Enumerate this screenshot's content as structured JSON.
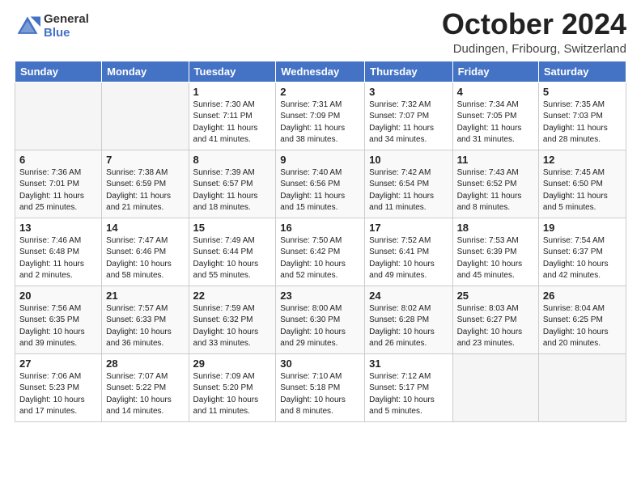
{
  "header": {
    "logo_general": "General",
    "logo_blue": "Blue",
    "month_title": "October 2024",
    "location": "Dudingen, Fribourg, Switzerland"
  },
  "columns": [
    "Sunday",
    "Monday",
    "Tuesday",
    "Wednesday",
    "Thursday",
    "Friday",
    "Saturday"
  ],
  "weeks": [
    [
      {
        "day": "",
        "info": ""
      },
      {
        "day": "",
        "info": ""
      },
      {
        "day": "1",
        "info": "Sunrise: 7:30 AM\nSunset: 7:11 PM\nDaylight: 11 hours and 41 minutes."
      },
      {
        "day": "2",
        "info": "Sunrise: 7:31 AM\nSunset: 7:09 PM\nDaylight: 11 hours and 38 minutes."
      },
      {
        "day": "3",
        "info": "Sunrise: 7:32 AM\nSunset: 7:07 PM\nDaylight: 11 hours and 34 minutes."
      },
      {
        "day": "4",
        "info": "Sunrise: 7:34 AM\nSunset: 7:05 PM\nDaylight: 11 hours and 31 minutes."
      },
      {
        "day": "5",
        "info": "Sunrise: 7:35 AM\nSunset: 7:03 PM\nDaylight: 11 hours and 28 minutes."
      }
    ],
    [
      {
        "day": "6",
        "info": "Sunrise: 7:36 AM\nSunset: 7:01 PM\nDaylight: 11 hours and 25 minutes."
      },
      {
        "day": "7",
        "info": "Sunrise: 7:38 AM\nSunset: 6:59 PM\nDaylight: 11 hours and 21 minutes."
      },
      {
        "day": "8",
        "info": "Sunrise: 7:39 AM\nSunset: 6:57 PM\nDaylight: 11 hours and 18 minutes."
      },
      {
        "day": "9",
        "info": "Sunrise: 7:40 AM\nSunset: 6:56 PM\nDaylight: 11 hours and 15 minutes."
      },
      {
        "day": "10",
        "info": "Sunrise: 7:42 AM\nSunset: 6:54 PM\nDaylight: 11 hours and 11 minutes."
      },
      {
        "day": "11",
        "info": "Sunrise: 7:43 AM\nSunset: 6:52 PM\nDaylight: 11 hours and 8 minutes."
      },
      {
        "day": "12",
        "info": "Sunrise: 7:45 AM\nSunset: 6:50 PM\nDaylight: 11 hours and 5 minutes."
      }
    ],
    [
      {
        "day": "13",
        "info": "Sunrise: 7:46 AM\nSunset: 6:48 PM\nDaylight: 11 hours and 2 minutes."
      },
      {
        "day": "14",
        "info": "Sunrise: 7:47 AM\nSunset: 6:46 PM\nDaylight: 10 hours and 58 minutes."
      },
      {
        "day": "15",
        "info": "Sunrise: 7:49 AM\nSunset: 6:44 PM\nDaylight: 10 hours and 55 minutes."
      },
      {
        "day": "16",
        "info": "Sunrise: 7:50 AM\nSunset: 6:42 PM\nDaylight: 10 hours and 52 minutes."
      },
      {
        "day": "17",
        "info": "Sunrise: 7:52 AM\nSunset: 6:41 PM\nDaylight: 10 hours and 49 minutes."
      },
      {
        "day": "18",
        "info": "Sunrise: 7:53 AM\nSunset: 6:39 PM\nDaylight: 10 hours and 45 minutes."
      },
      {
        "day": "19",
        "info": "Sunrise: 7:54 AM\nSunset: 6:37 PM\nDaylight: 10 hours and 42 minutes."
      }
    ],
    [
      {
        "day": "20",
        "info": "Sunrise: 7:56 AM\nSunset: 6:35 PM\nDaylight: 10 hours and 39 minutes."
      },
      {
        "day": "21",
        "info": "Sunrise: 7:57 AM\nSunset: 6:33 PM\nDaylight: 10 hours and 36 minutes."
      },
      {
        "day": "22",
        "info": "Sunrise: 7:59 AM\nSunset: 6:32 PM\nDaylight: 10 hours and 33 minutes."
      },
      {
        "day": "23",
        "info": "Sunrise: 8:00 AM\nSunset: 6:30 PM\nDaylight: 10 hours and 29 minutes."
      },
      {
        "day": "24",
        "info": "Sunrise: 8:02 AM\nSunset: 6:28 PM\nDaylight: 10 hours and 26 minutes."
      },
      {
        "day": "25",
        "info": "Sunrise: 8:03 AM\nSunset: 6:27 PM\nDaylight: 10 hours and 23 minutes."
      },
      {
        "day": "26",
        "info": "Sunrise: 8:04 AM\nSunset: 6:25 PM\nDaylight: 10 hours and 20 minutes."
      }
    ],
    [
      {
        "day": "27",
        "info": "Sunrise: 7:06 AM\nSunset: 5:23 PM\nDaylight: 10 hours and 17 minutes."
      },
      {
        "day": "28",
        "info": "Sunrise: 7:07 AM\nSunset: 5:22 PM\nDaylight: 10 hours and 14 minutes."
      },
      {
        "day": "29",
        "info": "Sunrise: 7:09 AM\nSunset: 5:20 PM\nDaylight: 10 hours and 11 minutes."
      },
      {
        "day": "30",
        "info": "Sunrise: 7:10 AM\nSunset: 5:18 PM\nDaylight: 10 hours and 8 minutes."
      },
      {
        "day": "31",
        "info": "Sunrise: 7:12 AM\nSunset: 5:17 PM\nDaylight: 10 hours and 5 minutes."
      },
      {
        "day": "",
        "info": ""
      },
      {
        "day": "",
        "info": ""
      }
    ]
  ]
}
